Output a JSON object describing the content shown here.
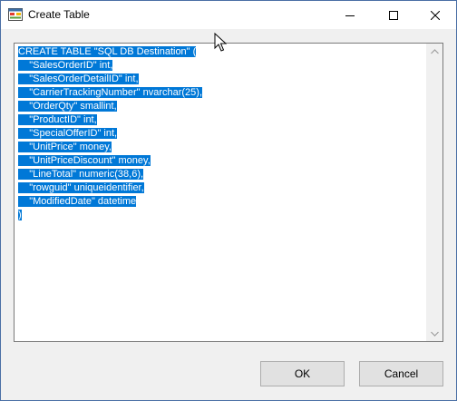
{
  "window": {
    "title": "Create Table"
  },
  "editor": {
    "lines": [
      "CREATE TABLE \"SQL DB Destination\" (",
      "    \"SalesOrderID\" int,",
      "    \"SalesOrderDetailID\" int,",
      "    \"CarrierTrackingNumber\" nvarchar(25),",
      "    \"OrderQty\" smallint,",
      "    \"ProductID\" int,",
      "    \"SpecialOfferID\" int,",
      "    \"UnitPrice\" money,",
      "    \"UnitPriceDiscount\" money,",
      "    \"LineTotal\" numeric(38,6),",
      "    \"rowguid\" uniqueidentifier,",
      "    \"ModifiedDate\" datetime",
      ")"
    ],
    "selection_color": "#0078d7"
  },
  "buttons": {
    "ok_label": "OK",
    "cancel_label": "Cancel"
  },
  "icons": {
    "app": "app-form-icon",
    "minimize": "minimize-icon",
    "maximize": "maximize-icon",
    "close": "close-icon",
    "scroll_up": "chevron-up-icon",
    "scroll_down": "chevron-down-icon"
  }
}
